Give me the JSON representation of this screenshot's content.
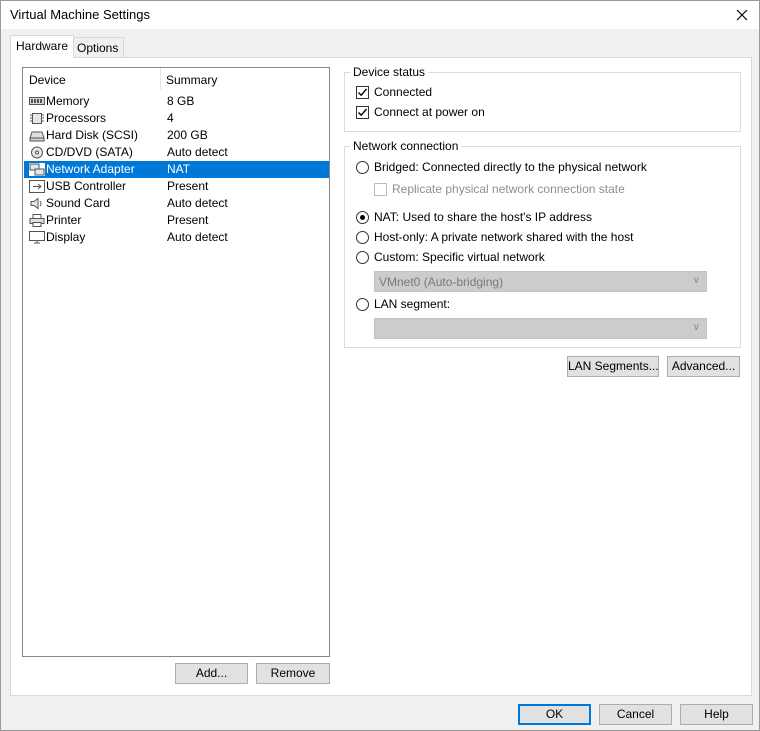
{
  "window": {
    "title": "Virtual Machine Settings"
  },
  "tabs": [
    {
      "label": "Hardware",
      "active": true
    },
    {
      "label": "Options",
      "active": false
    }
  ],
  "device_list": {
    "columns": [
      "Device",
      "Summary"
    ],
    "rows": [
      {
        "name": "Memory",
        "summary": "8 GB",
        "icon": "memory-icon"
      },
      {
        "name": "Processors",
        "summary": "4",
        "icon": "processor-icon"
      },
      {
        "name": "Hard Disk (SCSI)",
        "summary": "200 GB",
        "icon": "hard-disk-icon"
      },
      {
        "name": "CD/DVD (SATA)",
        "summary": "Auto detect",
        "icon": "cd-dvd-icon"
      },
      {
        "name": "Network Adapter",
        "summary": "NAT",
        "icon": "network-adapter-icon",
        "selected": true
      },
      {
        "name": "USB Controller",
        "summary": "Present",
        "icon": "usb-icon"
      },
      {
        "name": "Sound Card",
        "summary": "Auto detect",
        "icon": "speaker-icon"
      },
      {
        "name": "Printer",
        "summary": "Present",
        "icon": "printer-icon"
      },
      {
        "name": "Display",
        "summary": "Auto detect",
        "icon": "display-icon"
      }
    ],
    "add_label": "Add...",
    "remove_label": "Remove"
  },
  "device_status": {
    "label": "Device status",
    "connected": {
      "label": "Connected",
      "checked": true
    },
    "connect_at_power_on": {
      "label": "Connect at power on",
      "checked": true
    }
  },
  "network_connection": {
    "label": "Network connection",
    "bridged": {
      "label": "Bridged: Connected directly to the physical network",
      "selected": false
    },
    "replicate": {
      "label": "Replicate physical network connection state",
      "checked": false,
      "disabled": true
    },
    "nat": {
      "label": "NAT: Used to share the host's IP address",
      "selected": true
    },
    "host_only": {
      "label": "Host-only: A private network shared with the host",
      "selected": false
    },
    "custom": {
      "label": "Custom: Specific virtual network",
      "selected": false
    },
    "custom_network_value": "VMnet0 (Auto-bridging)",
    "lan_segment": {
      "label": "LAN segment:",
      "selected": false
    },
    "lan_segment_value": ""
  },
  "network_buttons": {
    "lan_segments_label": "LAN Segments...",
    "advanced_label": "Advanced..."
  },
  "footer": {
    "ok_label": "OK",
    "cancel_label": "Cancel",
    "help_label": "Help"
  },
  "colors": {
    "selection": "#0078d7",
    "panel": "#ffffff",
    "window": "#f0f0f0"
  }
}
